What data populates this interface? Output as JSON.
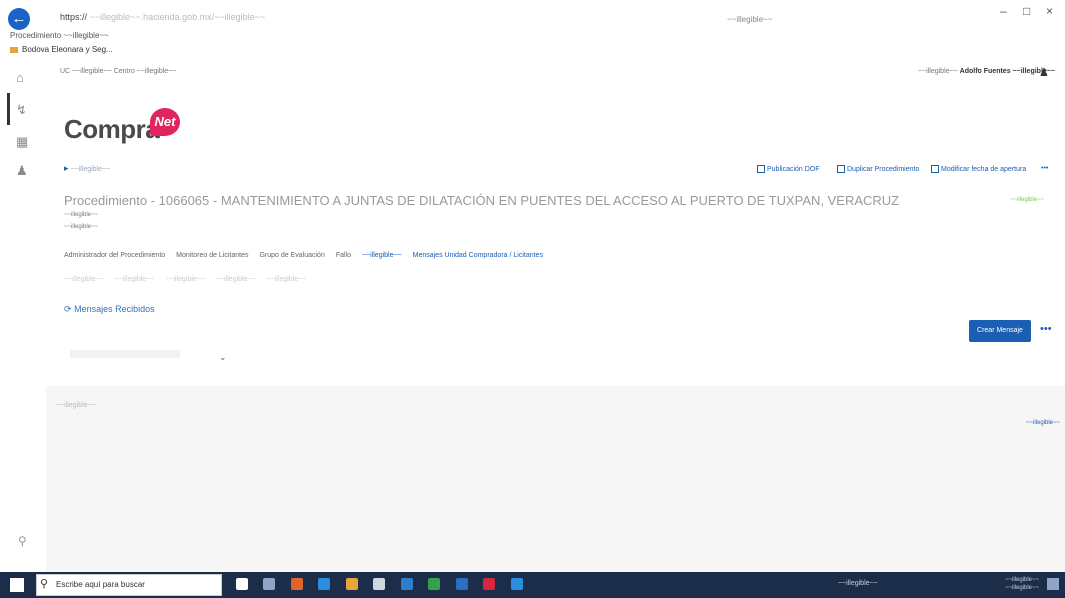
{
  "browser": {
    "address_prefix": "https://",
    "address_host": "~~illegible~~.hacienda.gob.mx",
    "address_path": "/~~illegible~~",
    "right_search": "~~illegible~~",
    "tab_title": "Procedimiento ~~illegible~~",
    "bookmark": "Bodova Eleonara y Seg..."
  },
  "top_bar": {
    "breadcrumb": "UC ~~illegible~~ Centro ~~illegible~~",
    "user_label": "~~illegible~~",
    "user_name": "Adolfo Fuentes ~~illegible~~"
  },
  "logo": {
    "text": "Compra",
    "badge": "Net"
  },
  "procedure": {
    "back_link": "~~illegible~~",
    "actions": [
      {
        "label": "Publicación DOF"
      },
      {
        "label": "Duplicar Procedimiento"
      },
      {
        "label": "Modificar fecha de apertura"
      }
    ],
    "more": "•••",
    "title": "Procedimiento - 1066065 - MANTENIMIENTO A JUNTAS DE DILATACIÓN EN PUENTES DEL ACCESO AL PUERTO DE TUXPAN, VERACRUZ",
    "status": "~~illegible~~",
    "meta_line1": "~~illegible~~",
    "meta_line2": "~~illegible~~"
  },
  "tabs_row1": [
    {
      "label": "Administrador del Procedimiento",
      "highlight": false
    },
    {
      "label": "Monitoreo de Licitantes",
      "highlight": false
    },
    {
      "label": "Grupo de Evaluación",
      "highlight": false
    },
    {
      "label": "Fallo",
      "highlight": false
    },
    {
      "label": "~~illegible~~",
      "highlight": false
    },
    {
      "label": "Mensajes Unidad Compradora / Licitantes",
      "highlight": true
    }
  ],
  "tabs_row2": [
    {
      "label": "~~illegible~~"
    },
    {
      "label": "~~illegible~~"
    },
    {
      "label": "~~illegible~~"
    },
    {
      "label": "~~illegible~~"
    },
    {
      "label": "~~illegible~~"
    }
  ],
  "messages": {
    "header": "Mensajes Recibidos",
    "new_button": "Crear Mensaje",
    "more": "•••",
    "chevron": "⌄",
    "left_small": "~~illegible~~",
    "right_link": "~~illegible~~"
  },
  "taskbar": {
    "search_placeholder": "Escribe aquí para buscar",
    "tray_text": "~~illegible~~",
    "time": "~~illegible~~",
    "date": "~~illegible~~"
  },
  "colors": {
    "accent": "#1a5fb4",
    "logo_badge": "#e0245e",
    "taskbar": "#1c2d4a"
  }
}
